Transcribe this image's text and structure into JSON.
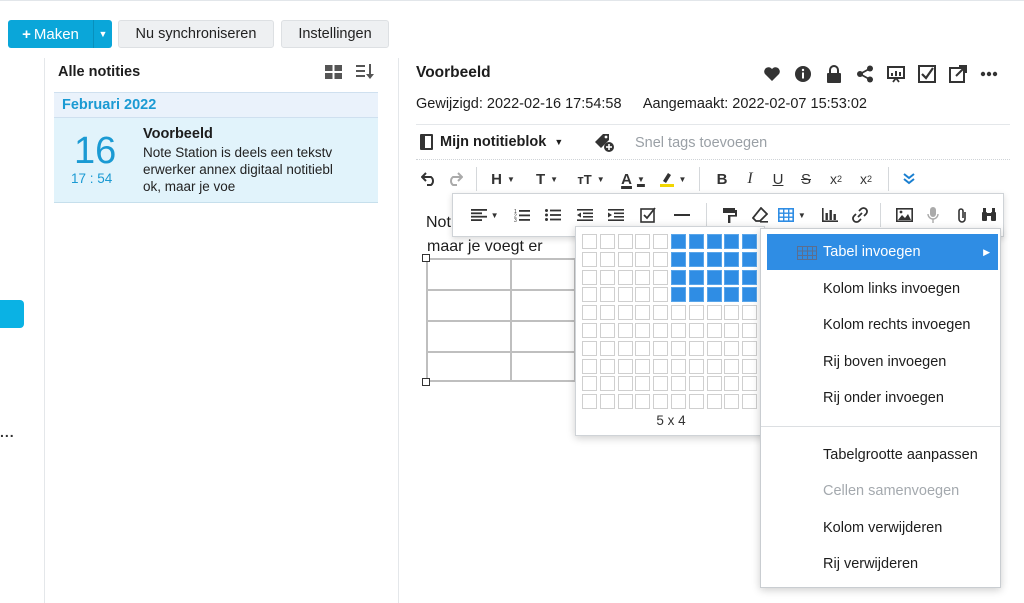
{
  "toolbar": {
    "make_label": "Maken",
    "sync_label": "Nu synchroniseren",
    "settings_label": "Instellingen",
    "left_more": "..."
  },
  "notes_list": {
    "title": "Alle notities",
    "group_label": "Februari 2022",
    "items": [
      {
        "day": "16",
        "time": "17 : 54",
        "title": "Voorbeeld",
        "snippet_lines": [
          "Note Station is deels een tekstv",
          "erwerker annex digitaal notitiebl",
          "ok, maar je voe"
        ]
      }
    ]
  },
  "editor": {
    "title": "Voorbeeld",
    "modified": "Gewijzigd: 2022-02-16 17:54:58",
    "created": "Aangemaakt: 2022-02-07 15:53:02",
    "notebook": "Mijn notitieblok",
    "tags_placeholder": "Snel tags toevoegen",
    "content_line1": "Not",
    "content_line2": "maar je voegt er",
    "header_icons": [
      "heart-icon",
      "info-icon",
      "lock-icon",
      "share-icon",
      "presentation-icon",
      "checkbox-icon",
      "popout-icon",
      "more-icon"
    ]
  },
  "table_picker": {
    "label": "5 x 4",
    "rows": 10,
    "cols": 10,
    "selected_rows": 4,
    "selected_cols": 5
  },
  "context_menu": {
    "items": [
      {
        "label": "Tabel invoegen",
        "state": "active"
      },
      {
        "label": "Kolom links invoegen",
        "state": "normal"
      },
      {
        "label": "Kolom rechts invoegen",
        "state": "normal"
      },
      {
        "label": "Rij boven invoegen",
        "state": "normal"
      },
      {
        "label": "Rij onder invoegen",
        "state": "normal"
      },
      {
        "label": "Tabelgrootte aanpassen",
        "state": "normal"
      },
      {
        "label": "Cellen samenvoegen",
        "state": "disabled"
      },
      {
        "label": "Kolom verwijderen",
        "state": "normal"
      },
      {
        "label": "Rij verwijderen",
        "state": "normal"
      }
    ]
  },
  "colors": {
    "accent": "#0aa6d9",
    "selection": "#2f8de4",
    "date_blue": "#1a9ad3"
  }
}
